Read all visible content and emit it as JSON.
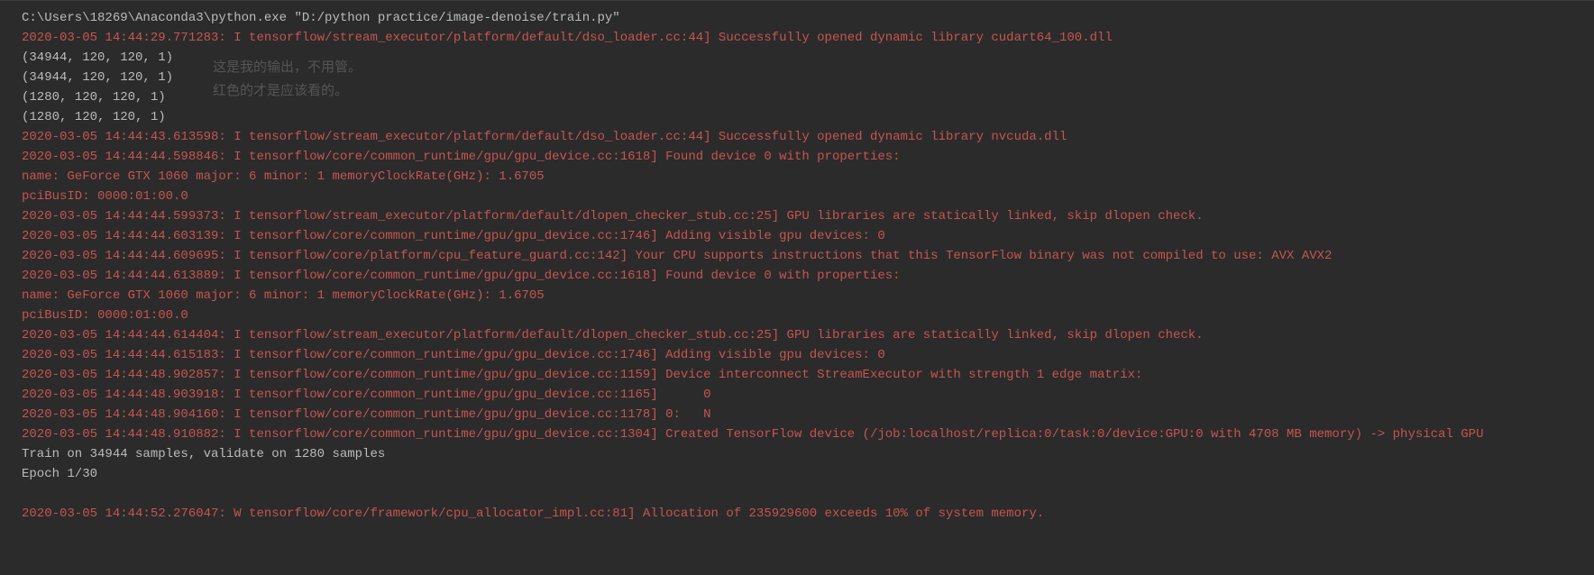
{
  "annotation_text": "这是我的输出，不用管。红色的才是应该看的。",
  "lines": [
    {
      "cls": "white",
      "text": "C:\\Users\\18269\\Anaconda3\\python.exe \"D:/python practice/image-denoise/train.py\""
    },
    {
      "cls": "red",
      "text": "2020-03-05 14:44:29.771283: I tensorflow/stream_executor/platform/default/dso_loader.cc:44] Successfully opened dynamic library cudart64_100.dll"
    },
    {
      "cls": "white",
      "text": "(34944, 120, 120, 1)"
    },
    {
      "cls": "white",
      "text": "(34944, 120, 120, 1)"
    },
    {
      "cls": "white",
      "text": "(1280, 120, 120, 1)"
    },
    {
      "cls": "white",
      "text": "(1280, 120, 120, 1)"
    },
    {
      "cls": "red",
      "text": "2020-03-05 14:44:43.613598: I tensorflow/stream_executor/platform/default/dso_loader.cc:44] Successfully opened dynamic library nvcuda.dll"
    },
    {
      "cls": "red",
      "text": "2020-03-05 14:44:44.598846: I tensorflow/core/common_runtime/gpu/gpu_device.cc:1618] Found device 0 with properties:"
    },
    {
      "cls": "red",
      "text": "name: GeForce GTX 1060 major: 6 minor: 1 memoryClockRate(GHz): 1.6705"
    },
    {
      "cls": "red",
      "text": "pciBusID: 0000:01:00.0"
    },
    {
      "cls": "red",
      "text": "2020-03-05 14:44:44.599373: I tensorflow/stream_executor/platform/default/dlopen_checker_stub.cc:25] GPU libraries are statically linked, skip dlopen check."
    },
    {
      "cls": "red",
      "text": "2020-03-05 14:44:44.603139: I tensorflow/core/common_runtime/gpu/gpu_device.cc:1746] Adding visible gpu devices: 0"
    },
    {
      "cls": "red",
      "text": "2020-03-05 14:44:44.609695: I tensorflow/core/platform/cpu_feature_guard.cc:142] Your CPU supports instructions that this TensorFlow binary was not compiled to use: AVX AVX2"
    },
    {
      "cls": "red",
      "text": "2020-03-05 14:44:44.613889: I tensorflow/core/common_runtime/gpu/gpu_device.cc:1618] Found device 0 with properties:"
    },
    {
      "cls": "red",
      "text": "name: GeForce GTX 1060 major: 6 minor: 1 memoryClockRate(GHz): 1.6705"
    },
    {
      "cls": "red",
      "text": "pciBusID: 0000:01:00.0"
    },
    {
      "cls": "red",
      "text": "2020-03-05 14:44:44.614404: I tensorflow/stream_executor/platform/default/dlopen_checker_stub.cc:25] GPU libraries are statically linked, skip dlopen check."
    },
    {
      "cls": "red",
      "text": "2020-03-05 14:44:44.615183: I tensorflow/core/common_runtime/gpu/gpu_device.cc:1746] Adding visible gpu devices: 0"
    },
    {
      "cls": "red",
      "text": "2020-03-05 14:44:48.902857: I tensorflow/core/common_runtime/gpu/gpu_device.cc:1159] Device interconnect StreamExecutor with strength 1 edge matrix:"
    },
    {
      "cls": "red",
      "text": "2020-03-05 14:44:48.903918: I tensorflow/core/common_runtime/gpu/gpu_device.cc:1165]      0"
    },
    {
      "cls": "red",
      "text": "2020-03-05 14:44:48.904160: I tensorflow/core/common_runtime/gpu/gpu_device.cc:1178] 0:   N"
    },
    {
      "cls": "red",
      "text": "2020-03-05 14:44:48.910882: I tensorflow/core/common_runtime/gpu/gpu_device.cc:1304] Created TensorFlow device (/job:localhost/replica:0/task:0/device:GPU:0 with 4708 MB memory) -> physical GPU "
    },
    {
      "cls": "white",
      "text": "Train on 34944 samples, validate on 1280 samples"
    },
    {
      "cls": "white",
      "text": "Epoch 1/30"
    },
    {
      "cls": "white",
      "text": ""
    },
    {
      "cls": "red",
      "text": "2020-03-05 14:44:52.276047: W tensorflow/core/framework/cpu_allocator_impl.cc:81] Allocation of 235929600 exceeds 10% of system memory."
    }
  ]
}
